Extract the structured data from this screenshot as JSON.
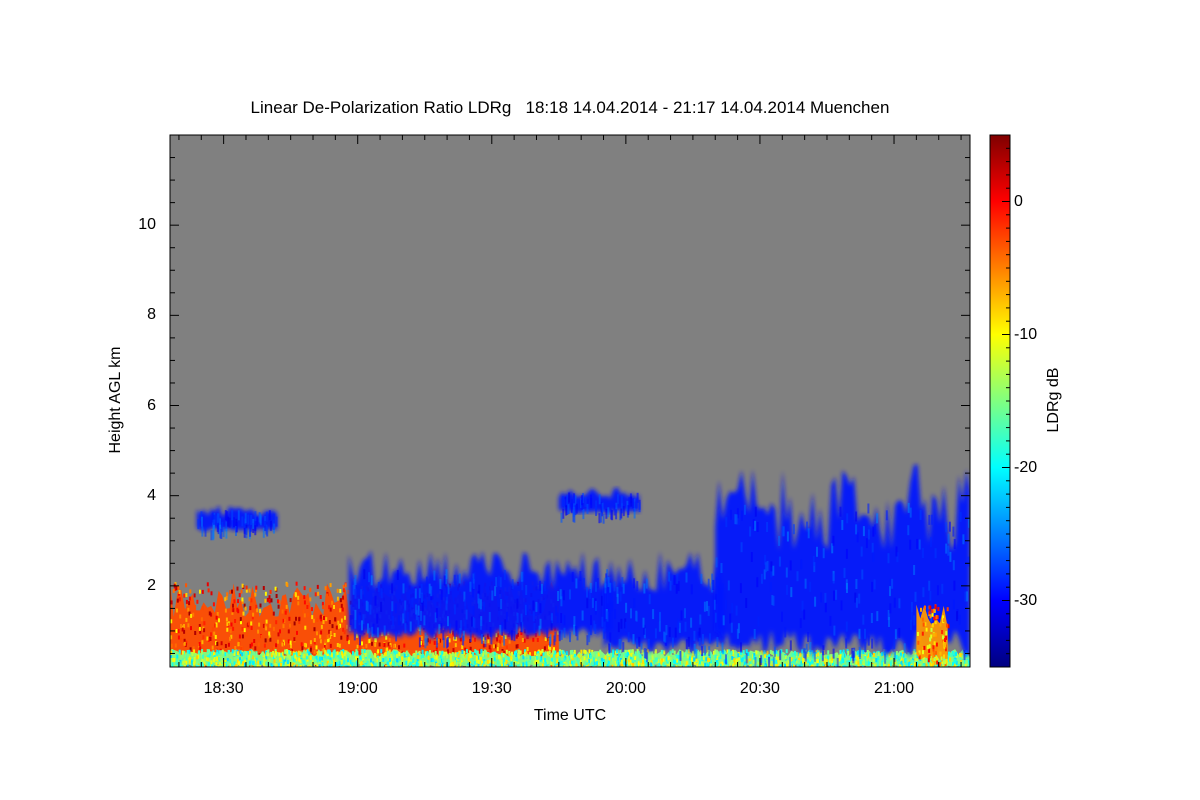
{
  "chart_data": {
    "type": "heatmap",
    "title": "Linear De-Polarization Ratio LDRg   18:18 14.04.2014 - 21:17 14.04.2014 Muenchen",
    "xlabel": "Time UTC",
    "ylabel": "Height AGL km",
    "xlim": [
      "18:18",
      "21:17"
    ],
    "ylim": [
      0.2,
      12
    ],
    "x_ticks": [
      "18:30",
      "19:00",
      "19:30",
      "20:00",
      "20:30",
      "21:00"
    ],
    "y_ticks": [
      2,
      4,
      6,
      8,
      10
    ],
    "colorbar": {
      "label": "LDRg dB",
      "range": [
        -35,
        5
      ],
      "ticks": [
        0,
        -10,
        -20,
        -30
      ],
      "colormap": "jet"
    },
    "no_signal_color": "#808080",
    "regions": [
      {
        "feature": "aerosol layer",
        "time_range": [
          "18:18",
          "19:45"
        ],
        "height_range": [
          0.2,
          2.1
        ],
        "ldr_db": -3
      },
      {
        "feature": "surface layer",
        "time_range": [
          "18:18",
          "21:17"
        ],
        "height_range": [
          0.2,
          0.6
        ],
        "ldr_db": -15
      },
      {
        "feature": "cloud layer",
        "time_range": [
          "18:24",
          "18:42"
        ],
        "height_range": [
          3.2,
          3.8
        ],
        "ldr_db": -29
      },
      {
        "feature": "cloud layer",
        "time_range": [
          "19:45",
          "20:03"
        ],
        "height_range": [
          3.6,
          4.2
        ],
        "ldr_db": -29
      },
      {
        "feature": "cloud",
        "time_range": [
          "18:58",
          "19:57"
        ],
        "height_range": [
          0.8,
          2.8
        ],
        "ldr_db": -29
      },
      {
        "feature": "cloud",
        "time_range": [
          "19:55",
          "20:22"
        ],
        "height_range": [
          0.5,
          2.8
        ],
        "ldr_db": -29
      },
      {
        "feature": "cloud",
        "time_range": [
          "20:20",
          "21:17"
        ],
        "height_range": [
          0.4,
          4.7
        ],
        "ldr_db": -29
      },
      {
        "feature": "high depolarization",
        "time_range": [
          "21:05",
          "21:12"
        ],
        "height_range": [
          0.3,
          1.6
        ],
        "ldr_db": -6
      }
    ]
  }
}
